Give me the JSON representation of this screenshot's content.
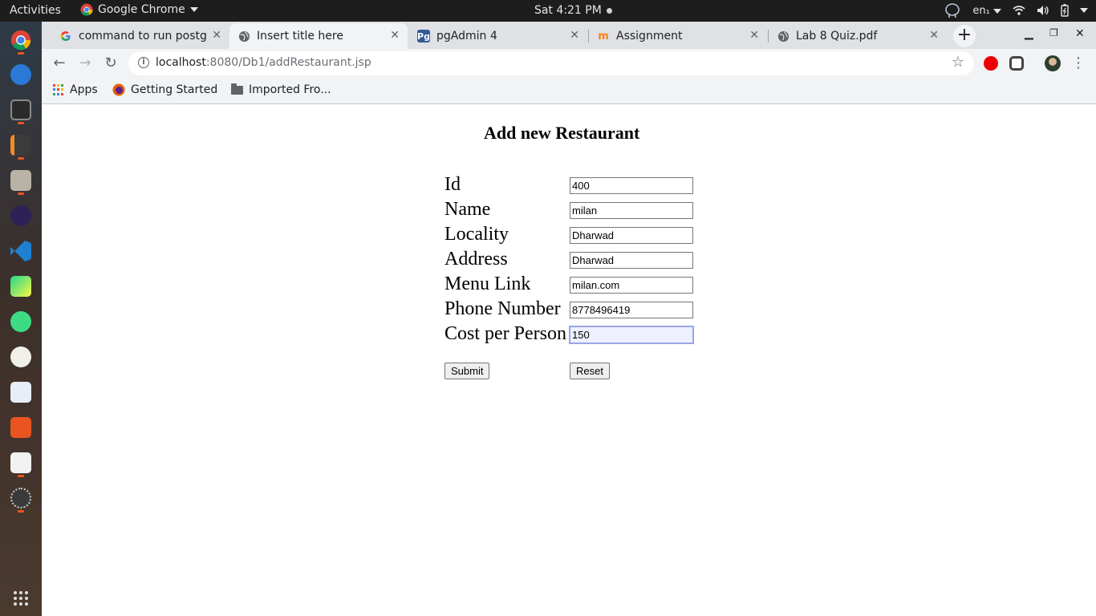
{
  "os": {
    "activities": "Activities",
    "app_name": "Google Chrome",
    "clock": "Sat  4:21 PM",
    "lang": "en₁"
  },
  "browser": {
    "tabs": [
      {
        "title": "command to run postgr",
        "icon": "google-icon"
      },
      {
        "title": "Insert title here",
        "icon": "globe-icon"
      },
      {
        "title": "pgAdmin 4",
        "icon": "pgadmin-icon"
      },
      {
        "title": "Assignment",
        "icon": "moodle-icon"
      },
      {
        "title": "Lab 8 Quiz.pdf",
        "icon": "globe-icon"
      }
    ],
    "url_host": "localhost",
    "url_path": ":8080/Db1/addRestaurant.jsp",
    "bookmarks": [
      "Apps",
      "Getting Started",
      "Imported Fro..."
    ]
  },
  "form": {
    "title": "Add new Restaurant",
    "fields": [
      {
        "label": "Id",
        "value": "400"
      },
      {
        "label": "Name",
        "value": "milan"
      },
      {
        "label": "Locality",
        "value": "Dharwad"
      },
      {
        "label": "Address",
        "value": "Dharwad"
      },
      {
        "label": "Menu Link",
        "value": "milan.com"
      },
      {
        "label": "Phone Number",
        "value": "8778496419"
      },
      {
        "label": "Cost per Person",
        "value": "150"
      }
    ],
    "submit_label": "Submit",
    "reset_label": "Reset"
  },
  "colors": {
    "topbar": "#1d1d1d",
    "tabstrip": "#dfe1e5",
    "toolbar": "#f1f3f4",
    "ubuntu_accent": "#e95420"
  }
}
